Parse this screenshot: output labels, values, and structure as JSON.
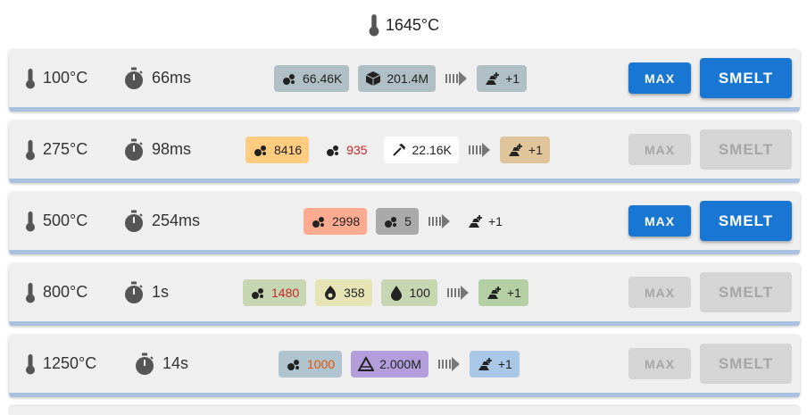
{
  "header": {
    "temperature": "1645°C"
  },
  "recipes": [
    {
      "temp": "100°C",
      "time": "66ms",
      "inputs": [
        {
          "icon": "ore-icon",
          "value": "66.46K",
          "bg": "#b0bec5",
          "color": "#222"
        },
        {
          "icon": "cube-icon",
          "value": "201.4M",
          "bg": "#b0bec5",
          "color": "#222"
        }
      ],
      "output": {
        "icon": "ingot-icon",
        "value": "+1",
        "bg": "#b0bec5"
      },
      "max_label": "MAX",
      "smelt_label": "SMELT",
      "enabled": true
    },
    {
      "temp": "275°C",
      "time": "98ms",
      "inputs": [
        {
          "icon": "ore-icon",
          "value": "8416",
          "bg": "#ffcc80",
          "color": "#222"
        },
        {
          "icon": "ore-icon",
          "value": "935",
          "bg": "#efefef",
          "color": "#c62828"
        },
        {
          "icon": "pickaxe-icon",
          "value": "22.16K",
          "bg": "#ffffff",
          "color": "#222"
        }
      ],
      "output": {
        "icon": "ingot-icon",
        "value": "+1",
        "bg": "#e0c59a"
      },
      "max_label": "MAX",
      "smelt_label": "SMELT",
      "enabled": false
    },
    {
      "temp": "500°C",
      "time": "254ms",
      "inputs": [
        {
          "icon": "ore-icon",
          "value": "2998",
          "bg": "#ffab91",
          "color": "#222"
        },
        {
          "icon": "ore-icon",
          "value": "5",
          "bg": "#a9a9a9",
          "color": "#222"
        }
      ],
      "output": {
        "icon": "ingot-icon",
        "value": "+1",
        "bg": "#efefef"
      },
      "max_label": "MAX",
      "smelt_label": "SMELT",
      "enabled": true
    },
    {
      "temp": "800°C",
      "time": "1s",
      "inputs": [
        {
          "icon": "ore-icon",
          "value": "1480",
          "bg": "#c5d6b0",
          "color": "#c62828"
        },
        {
          "icon": "flame-icon",
          "value": "358",
          "bg": "#e6e4b5",
          "color": "#222"
        },
        {
          "icon": "drop-icon",
          "value": "100",
          "bg": "#c5d6b0",
          "color": "#222"
        }
      ],
      "output": {
        "icon": "ingot-icon",
        "value": "+1",
        "bg": "#b5cfa5"
      },
      "max_label": "MAX",
      "smelt_label": "SMELT",
      "enabled": false
    },
    {
      "temp": "1250°C",
      "time": "14s",
      "inputs": [
        {
          "icon": "ore-icon",
          "value": "1000",
          "bg": "#b0c4d0",
          "color": "#e65100"
        },
        {
          "icon": "pile-icon",
          "value": "2.000M",
          "bg": "#b39ddb",
          "color": "#222"
        }
      ],
      "output": {
        "icon": "ingot-icon",
        "value": "+1",
        "bg": "#a9c8e8"
      },
      "max_label": "MAX",
      "smelt_label": "SMELT",
      "enabled": false
    }
  ]
}
